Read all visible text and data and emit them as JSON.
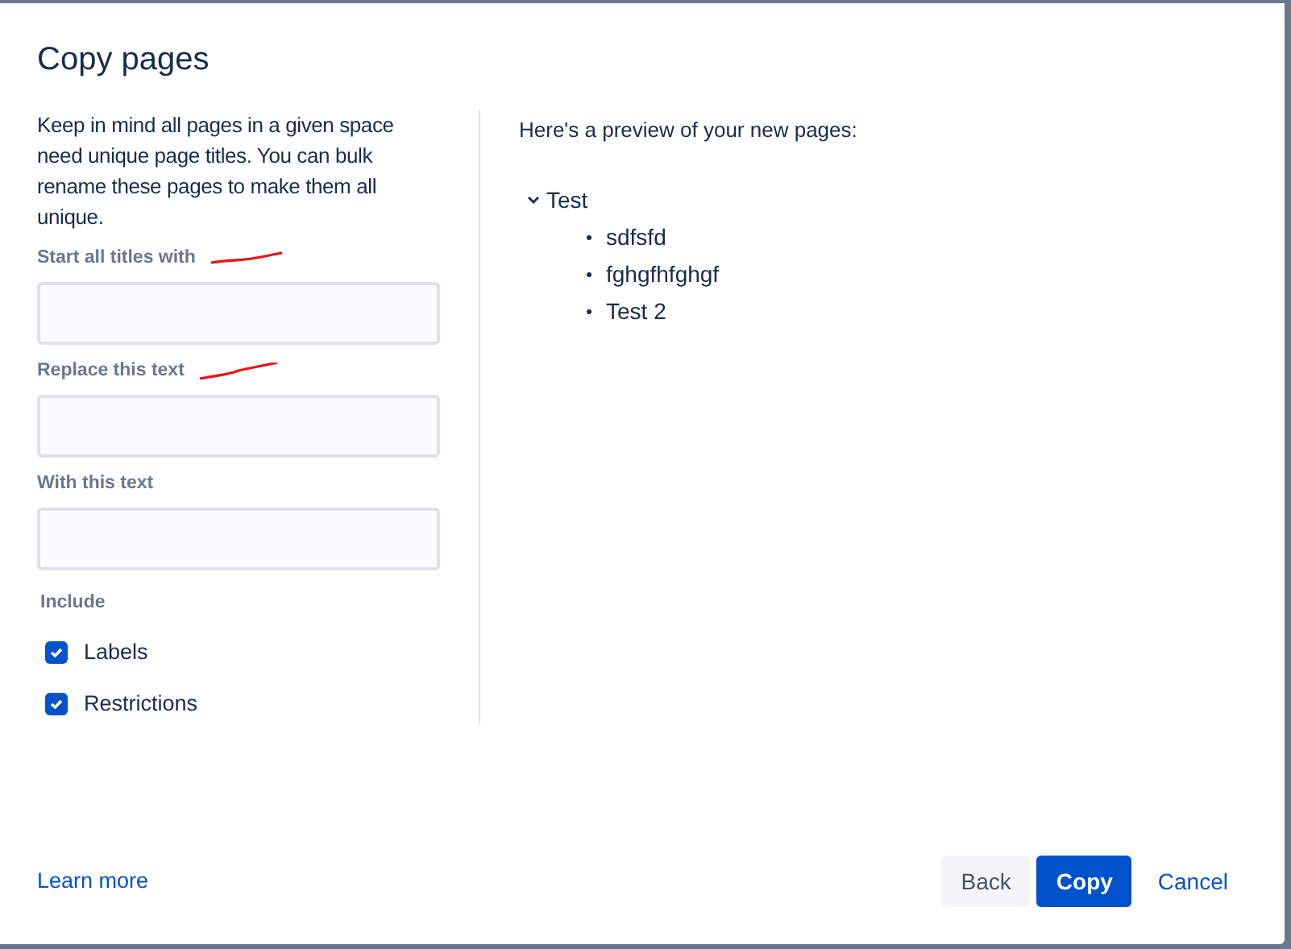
{
  "dialog": {
    "title": "Copy pages",
    "intro": "Keep in mind all pages in a given space need unique page titles. You can bulk rename these pages to make them all unique.",
    "fields": [
      {
        "label": "Start all titles with",
        "marked": true
      },
      {
        "label": "Replace this text",
        "marked": true
      },
      {
        "label": "With this text",
        "marked": false
      }
    ],
    "include": {
      "label": "Include",
      "options": [
        {
          "label": "Labels",
          "checked": true
        },
        {
          "label": "Restrictions",
          "checked": true
        }
      ]
    },
    "preview": {
      "heading": "Here's a preview of your new pages:",
      "tree": [
        {
          "label": "Test",
          "expanded": true,
          "children": [
            {
              "label": "sdfsfd"
            },
            {
              "label": "fghgfhfghgf"
            },
            {
              "label": "Test 2"
            }
          ]
        }
      ]
    },
    "footer": {
      "link": "Learn more",
      "buttons": [
        {
          "label": "Back",
          "kind": "subtle"
        },
        {
          "label": "Copy",
          "kind": "primary"
        },
        {
          "label": "Cancel",
          "kind": "link"
        }
      ]
    }
  }
}
